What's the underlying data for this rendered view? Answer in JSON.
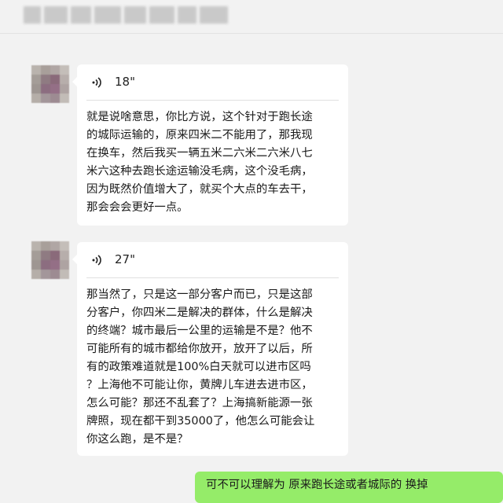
{
  "header": {
    "contact_name_obscured": true
  },
  "messages": [
    {
      "sender": "other",
      "type": "voice",
      "duration": "18\"",
      "transcript": "就是说啥意思，你比方说，这个针对于跑长途\n的城际运输的，原来四米二不能用了，那我现\n在换车，然后我买一辆五米二六米二六米八七\n米六这种去跑长途运输没毛病，这个没毛病，\n因为既然价值增大了，就买个大点的车去干，\n那会会会更好一点。"
    },
    {
      "sender": "other",
      "type": "voice",
      "duration": "27\"",
      "transcript": "那当然了，只是这一部分客户而已，只是这部\n分客户，你四米二是解决的群体，什么是解决\n的终端？城市最后一公里的运输是不是？他不\n可能所有的城市都给你放开，放开了以后，所\n有的政策难道就是100%白天就可以进市区吗\n？上海他不可能让你，黄牌儿车进去进市区，\n怎么可能？那还不乱套了？上海搞新能源一张\n牌照，现在都干到35000了，他怎么可能会让\n你这么跑，是不是？"
    },
    {
      "sender": "self",
      "type": "text",
      "text": "可不可以理解为 原来跑长途或者城际的 换掉"
    }
  ],
  "colors": {
    "background": "#f2f2f2",
    "incoming_bubble": "#ffffff",
    "outgoing_bubble": "#95ec69"
  },
  "icons": {
    "voice": "sound-wave-icon"
  }
}
